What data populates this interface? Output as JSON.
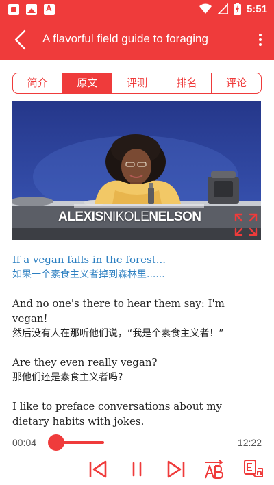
{
  "status_bar": {
    "time": "5:51",
    "icons": [
      "notification-square-icon",
      "image-icon",
      "pdf-icon",
      "wifi-icon",
      "signal-icon",
      "battery-charging-icon"
    ]
  },
  "app_bar": {
    "title": "A flavorful field guide to foraging",
    "icons": {
      "back": "back-chevron-icon",
      "more": "more-vert-icon"
    }
  },
  "tabs": [
    {
      "label": "简介",
      "active": false
    },
    {
      "label": "原文",
      "active": true
    },
    {
      "label": "评测",
      "active": false
    },
    {
      "label": "排名",
      "active": false
    },
    {
      "label": "评论",
      "active": false
    }
  ],
  "video": {
    "caption_first": "ALEXIS",
    "caption_middle": "NIKOLE",
    "caption_last": "NELSON",
    "fullscreen_icon": "fullscreen-icon"
  },
  "transcript": [
    {
      "en": "If a vegan falls in the forest...",
      "zh": "如果一个素食主义者掉到森林里......",
      "current": true
    },
    {
      "en": "And no one's there to hear them say: I'm vegan!",
      "zh": "然后没有人在那听他们说，“我是个素食主义者！”",
      "current": false
    },
    {
      "en": "Are they even really vegan?",
      "zh": "那他们还是素食主义者吗?",
      "current": false
    },
    {
      "en": "I like to preface conversations about my dietary habits with jokes.",
      "zh": "",
      "current": false
    }
  ],
  "player": {
    "elapsed": "00:04",
    "total": "12:22",
    "progress": 0.005,
    "controls": [
      "previous-icon",
      "pause-icon",
      "next-icon",
      "text-size-icon",
      "translate-toggle-icon"
    ]
  },
  "colors": {
    "accent": "#ef3b3b",
    "highlight_text": "#2c7fc1",
    "video_bg": "#2a3d8f"
  }
}
